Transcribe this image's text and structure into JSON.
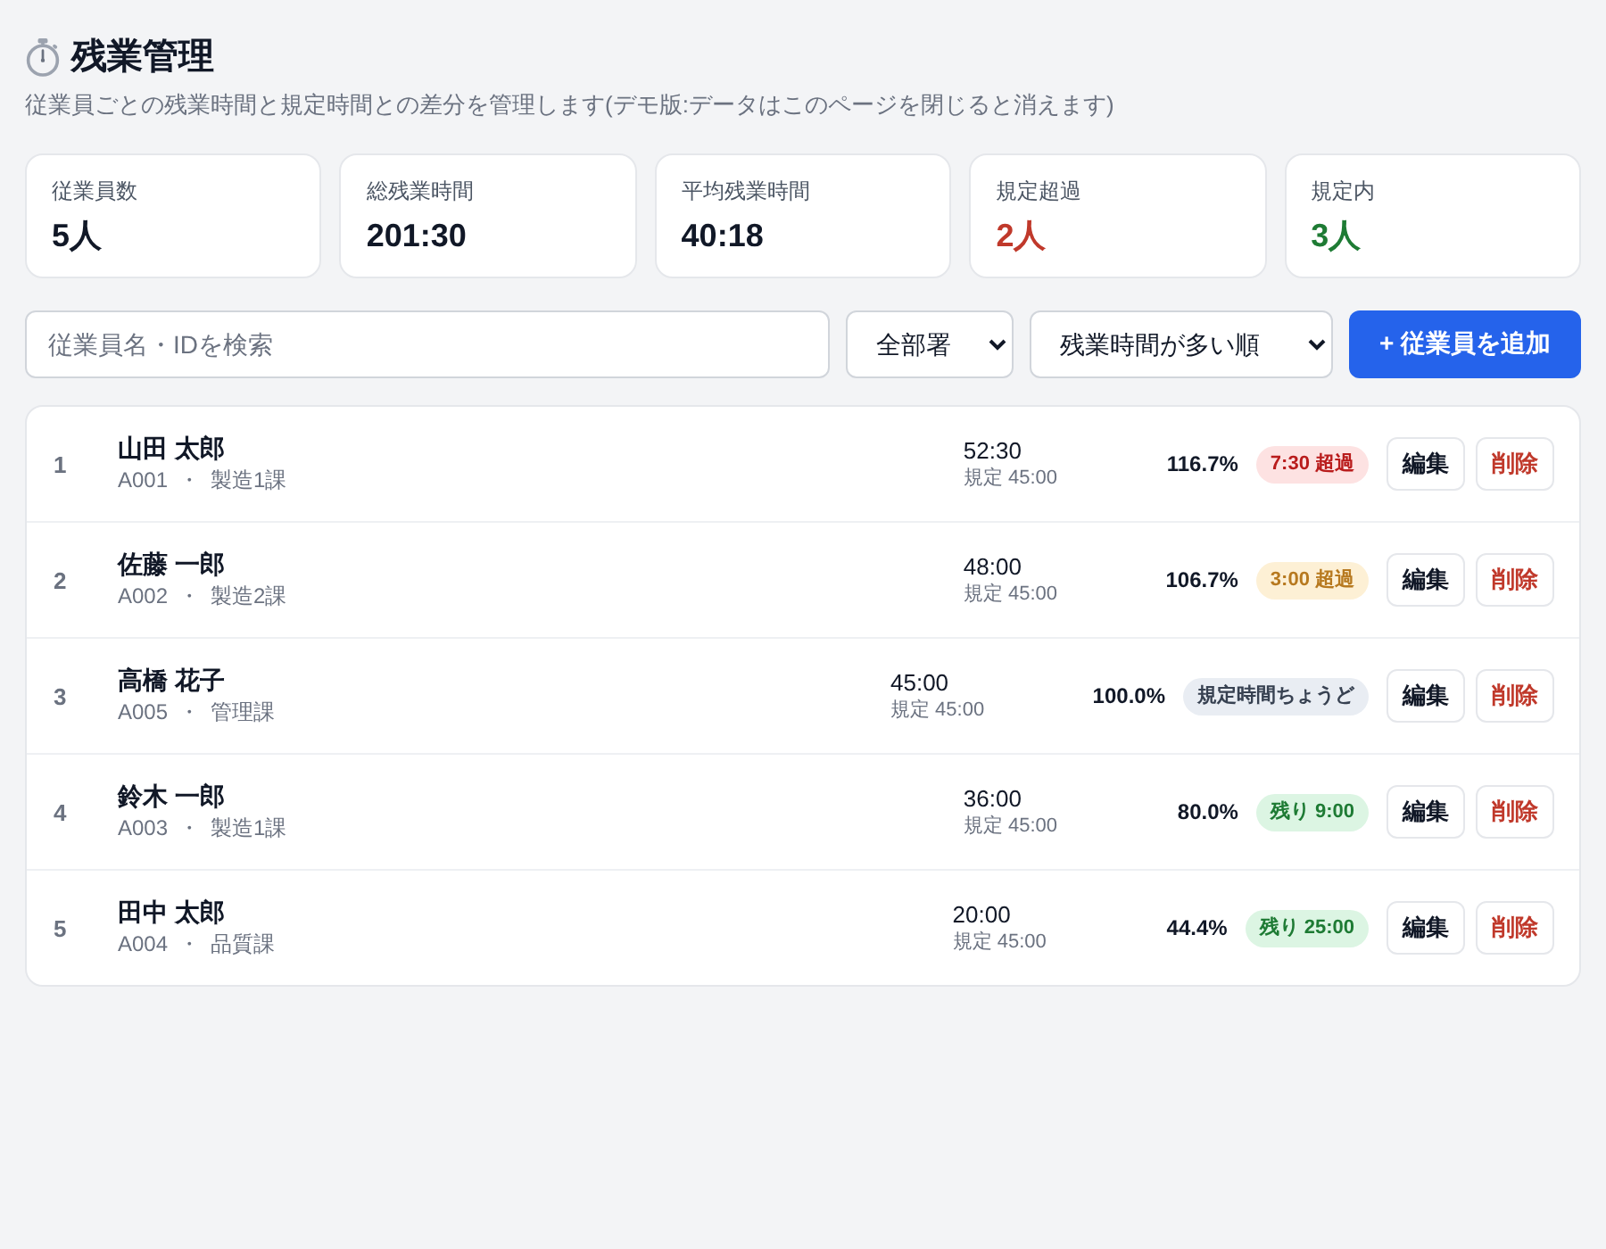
{
  "header": {
    "title": "残業管理",
    "subtitle": "従業員ごとの残業時間と規定時間との差分を管理します(デモ版:データはこのページを閉じると消えます)"
  },
  "stats": [
    {
      "label": "従業員数",
      "value": "5人",
      "kind": "plain"
    },
    {
      "label": "総残業時間",
      "value": "201:30",
      "kind": "plain"
    },
    {
      "label": "平均残業時間",
      "value": "40:18",
      "kind": "plain"
    },
    {
      "label": "規定超過",
      "value": "2人",
      "kind": "over"
    },
    {
      "label": "規定内",
      "value": "3人",
      "kind": "within"
    }
  ],
  "toolbar": {
    "search": {
      "placeholder": "従業員名・IDを検索"
    },
    "department_filter": "全部署",
    "sort": "残業時間が多い順",
    "add_button": "+ 従業員を追加"
  },
  "rows": [
    {
      "index": "1",
      "name": "山田 太郎",
      "id": "A001",
      "separator": "・",
      "department": "製造1課",
      "hours": "52:30",
      "limit": "規定 45:00",
      "percent": "116.7%",
      "badge": "7:30 超過",
      "kind": "danger",
      "edit": "編集",
      "delete": "削除"
    },
    {
      "index": "2",
      "name": "佐藤 一郎",
      "id": "A002",
      "separator": "・",
      "department": "製造2課",
      "hours": "48:00",
      "limit": "規定 45:00",
      "percent": "106.7%",
      "badge": "3:00 超過",
      "kind": "warning",
      "edit": "編集",
      "delete": "削除"
    },
    {
      "index": "3",
      "name": "高橋 花子",
      "id": "A005",
      "separator": "・",
      "department": "管理課",
      "hours": "45:00",
      "limit": "規定 45:00",
      "percent": "100.0%",
      "badge": "規定時間ちょうど",
      "kind": "neutral",
      "edit": "編集",
      "delete": "削除"
    },
    {
      "index": "4",
      "name": "鈴木 一郎",
      "id": "A003",
      "separator": "・",
      "department": "製造1課",
      "hours": "36:00",
      "limit": "規定 45:00",
      "percent": "80.0%",
      "badge": "残り 9:00",
      "kind": "success",
      "edit": "編集",
      "delete": "削除"
    },
    {
      "index": "5",
      "name": "田中 太郎",
      "id": "A004",
      "separator": "・",
      "department": "品質課",
      "hours": "20:00",
      "limit": "規定 45:00",
      "percent": "44.4%",
      "badge": "残り 25:00",
      "kind": "success",
      "edit": "編集",
      "delete": "削除"
    }
  ]
}
